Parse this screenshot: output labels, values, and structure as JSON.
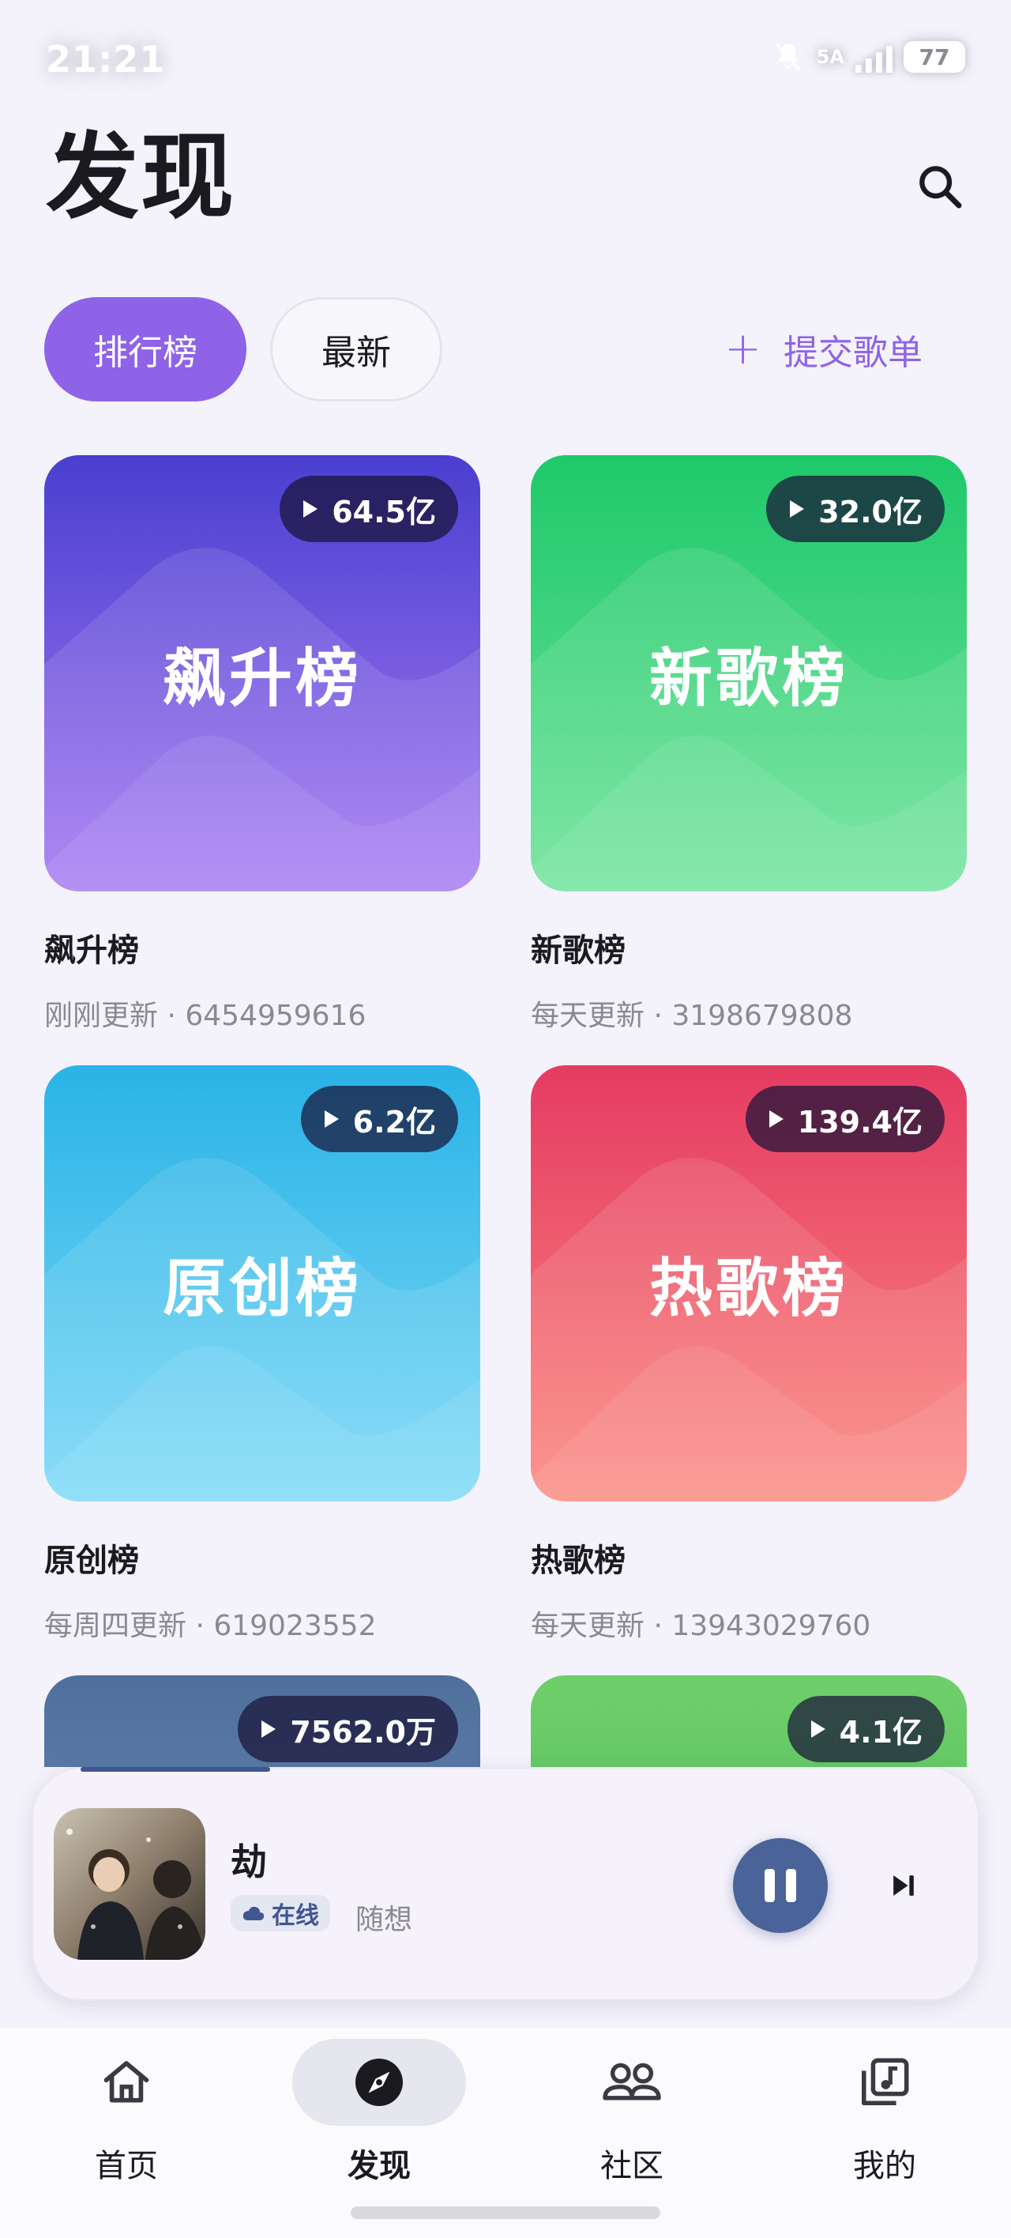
{
  "status_bar": {
    "time": "21:21",
    "network": "5A",
    "battery": "77"
  },
  "header": {
    "title": "发现",
    "search_icon": "search-icon"
  },
  "tabs": [
    {
      "label": "排行榜",
      "active": true
    },
    {
      "label": "最新",
      "active": false
    }
  ],
  "submit_playlist": {
    "icon": "plus-icon",
    "label": "提交歌单"
  },
  "charts": [
    {
      "cover_title": "飙升榜",
      "plays": "64.5亿",
      "name": "飙升榜",
      "meta": "刚刚更新 · 6454959616",
      "colors": [
        "#4a3fd0",
        "#a77bf2"
      ]
    },
    {
      "cover_title": "新歌榜",
      "plays": "32.0亿",
      "name": "新歌榜",
      "meta": "每天更新 · 3198679808",
      "colors": [
        "#1fc96a",
        "#6fe39b"
      ]
    },
    {
      "cover_title": "原创榜",
      "plays": "6.2亿",
      "name": "原创榜",
      "meta": "每周四更新 · 619023552",
      "colors": [
        "#2ab3e6",
        "#7dd9f7"
      ]
    },
    {
      "cover_title": "热歌榜",
      "plays": "139.4亿",
      "name": "热歌榜",
      "meta": "每天更新 · 13943029760",
      "colors": [
        "#e53b62",
        "#fb8a80"
      ]
    },
    {
      "cover_title": "",
      "plays": "7562.0万",
      "name": "",
      "meta": "",
      "colors": [
        "#4f6f9c",
        "#7b97c0"
      ]
    },
    {
      "cover_title": "",
      "plays": "4.1亿",
      "name": "",
      "meta": "",
      "colors": [
        "#59c25a",
        "#48b85a"
      ]
    }
  ],
  "player": {
    "song": "劫",
    "source": "在线",
    "source_icon": "cloud-icon",
    "artist": "随想",
    "progress": 0.2,
    "pause_icon": "pause-icon",
    "next_icon": "skip-next-icon"
  },
  "bottom_nav": [
    {
      "label": "首页",
      "icon": "home-icon",
      "active": false
    },
    {
      "label": "发现",
      "icon": "compass-icon",
      "active": true
    },
    {
      "label": "社区",
      "icon": "people-icon",
      "active": false
    },
    {
      "label": "我的",
      "icon": "music-library-icon",
      "active": false
    }
  ]
}
